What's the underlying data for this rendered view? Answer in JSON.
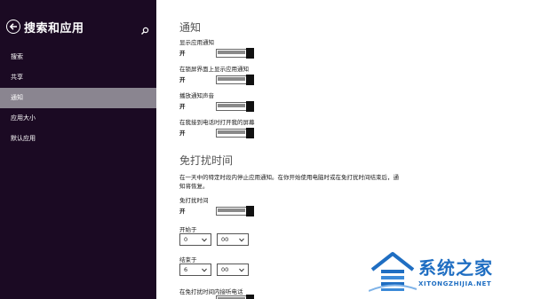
{
  "sidebar": {
    "title": "搜索和应用",
    "items": [
      {
        "label": "搜索"
      },
      {
        "label": "共享"
      },
      {
        "label": "通知"
      },
      {
        "label": "应用大小"
      },
      {
        "label": "默认应用"
      }
    ],
    "selected_item": "通知",
    "back_icon": "back-arrow-icon",
    "search_icon": "search-icon",
    "background_color": "#1b0a23",
    "selected_color": "#8a8590"
  },
  "notifications": {
    "heading": "通知",
    "settings": [
      {
        "label": "显示应用通知",
        "state": "开",
        "on": true
      },
      {
        "label": "在锁屏界面上显示应用通知",
        "state": "开",
        "on": true
      },
      {
        "label": "播放通知声音",
        "state": "开",
        "on": true
      },
      {
        "label": "在我接到电话时打开我的屏幕",
        "state": "开",
        "on": true
      }
    ]
  },
  "quiet_hours": {
    "heading": "免打扰时间",
    "description": "在一天中的特定时段内停止应用通知。在你开始使用电脑时或在免打扰时间结束后，通知将恢复。",
    "toggle": {
      "label": "免打扰时间",
      "state": "开",
      "on": true
    },
    "start": {
      "label": "开始于",
      "hour": "0",
      "minute": "00"
    },
    "end": {
      "label": "结束于",
      "hour": "6",
      "minute": "00"
    },
    "calls": {
      "label": "在免打扰时间内接听电话"
    }
  },
  "watermark": {
    "text": "系统之家",
    "url": "XITONGZHIJIA.NET"
  }
}
